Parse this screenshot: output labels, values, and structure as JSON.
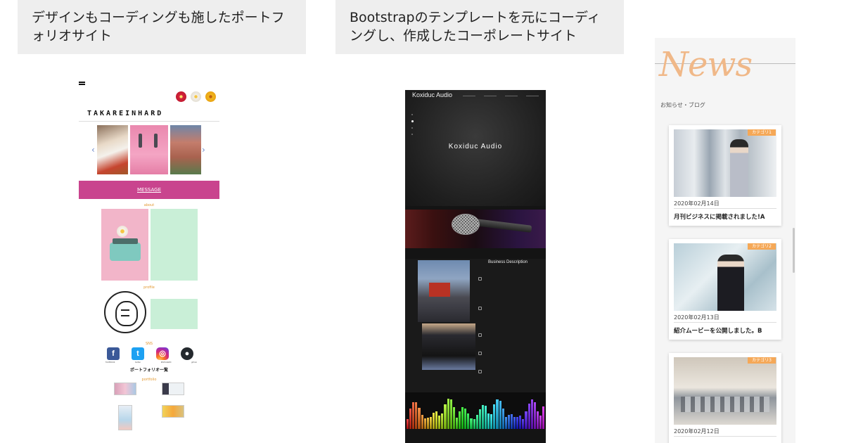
{
  "captions": {
    "portfolio": "デザインもコーディングも施したポートフォリオサイト",
    "corporate": "Bootstrapのテンプレートを元にコーディングし、作成したコーポレートサイト"
  },
  "portfolio": {
    "brand": "TAKAREINHARD",
    "message_label": "MESSAGE",
    "section_about": "about",
    "section_profile": "profile",
    "section_sns": "SNS",
    "section_portfolio": "portfolio",
    "list_title": "ポートフォリオ一覧",
    "sns_labels": [
      "FACEBOOK",
      "twitter",
      "INSTAGRAM",
      "github"
    ],
    "colors": {
      "message_bar": "#c9448e",
      "section_label": "#e39a34",
      "card_green": "#c9efd7"
    }
  },
  "corporate": {
    "logo": "Koxiduc Audio",
    "hero_title": "Koxiduc Audio",
    "business_title": "Business Description",
    "colors": {
      "background": "#141414"
    }
  },
  "news": {
    "title": "News",
    "subtitle": "お知らせ・ブログ",
    "cards": [
      {
        "tag": "カテゴリ1",
        "date": "2020年02月14日",
        "headline": "月刊ビジネスに掲載されました!A"
      },
      {
        "tag": "カテゴリ2",
        "date": "2020年02月13日",
        "headline": "紹介ムービーを公開しました。B"
      },
      {
        "tag": "カテゴリ3",
        "date": "2020年02月12日"
      }
    ],
    "colors": {
      "title": "#f0b888",
      "tag": "#f5a857"
    }
  }
}
